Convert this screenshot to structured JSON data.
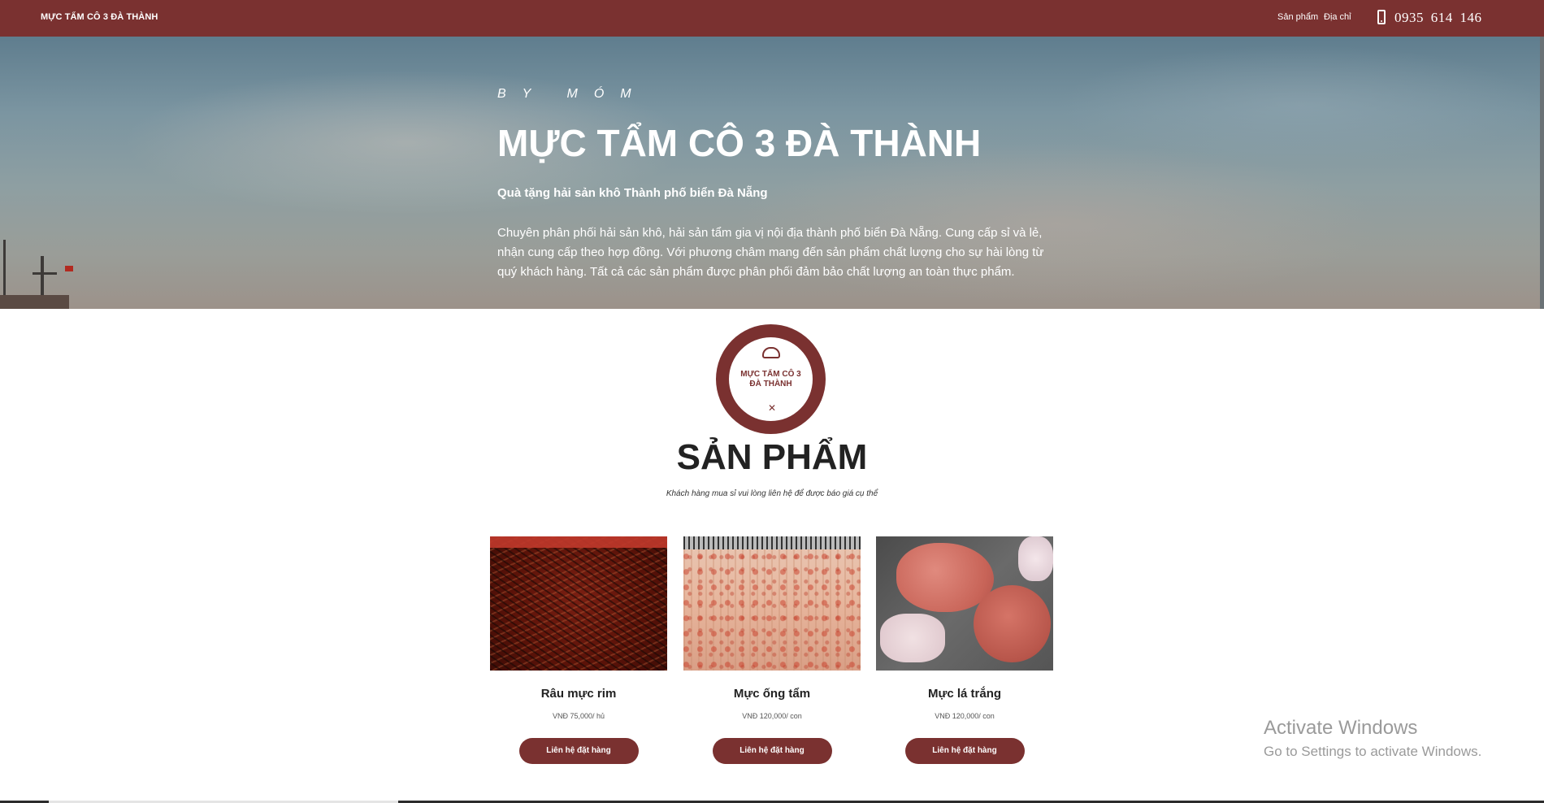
{
  "nav": {
    "brand": "MỰC TẨM CÔ 3 ĐÀ THÀNH",
    "links": [
      {
        "label": "Sản phẩm"
      },
      {
        "label": "Địa chỉ"
      }
    ],
    "phone": "0935 614 146",
    "phone_icon": "phone-icon"
  },
  "hero": {
    "tagline": "BY MÓM",
    "title": "MỰC TẨM CÔ 3 ĐÀ THÀNH",
    "subtitle": "Quà tặng hải sản khô Thành phố biển Đà Nẵng",
    "description": "Chuyên phân phối hải sản khô, hải sản tẩm gia vị nội địa thành phố biển Đà Nẵng. Cung cấp sỉ và lẻ, nhận cung cấp theo hợp đồng. Với phương châm mang đến sản phẩm chất lượng cho sự hài lòng từ quý khách hàng. Tất cả các sản phẩm được phân phối đảm bảo chất lượng an toàn thực phẩm."
  },
  "logo": {
    "text": "MỰC TẨM CÔ 3 ĐÀ THÀNH"
  },
  "products_section": {
    "title": "SẢN PHẨM",
    "note": "Khách hàng mua sỉ vui lòng liên hệ để được báo giá cụ thể",
    "items": [
      {
        "name": "Râu mực rim",
        "price": "VNĐ 75,000/ hủ",
        "button": "Liên hệ đặt hàng"
      },
      {
        "name": "Mực ống tẩm",
        "price": "VNĐ 120,000/ con",
        "button": "Liên hệ đặt hàng"
      },
      {
        "name": "Mực lá trắng",
        "price": "VNĐ 120,000/ con",
        "button": "Liên hệ đặt hàng"
      }
    ]
  },
  "windows_watermark": {
    "title": "Activate Windows",
    "subtitle": "Go to Settings to activate Windows."
  },
  "colors": {
    "brand": "#7a3130"
  }
}
